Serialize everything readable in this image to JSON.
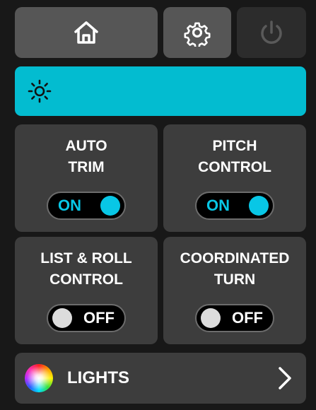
{
  "topbar": {
    "home_icon": "home-icon",
    "settings_icon": "gear-icon",
    "power_icon": "power-icon"
  },
  "brightness": {
    "icon": "sun-icon",
    "accent_color": "#03bcd0"
  },
  "controls": [
    {
      "label": "AUTO\nTRIM",
      "state": "ON"
    },
    {
      "label": "PITCH\nCONTROL",
      "state": "ON"
    },
    {
      "label": "LIST & ROLL\nCONTROL",
      "state": "OFF"
    },
    {
      "label": "COORDINATED\nTURN",
      "state": "OFF"
    }
  ],
  "lights": {
    "label": "LIGHTS",
    "icon": "color-wheel-icon",
    "chevron_icon": "chevron-right-icon"
  },
  "colors": {
    "on_color": "#08c7e6",
    "tile_color": "#3d3d3d",
    "background": "#181818"
  }
}
